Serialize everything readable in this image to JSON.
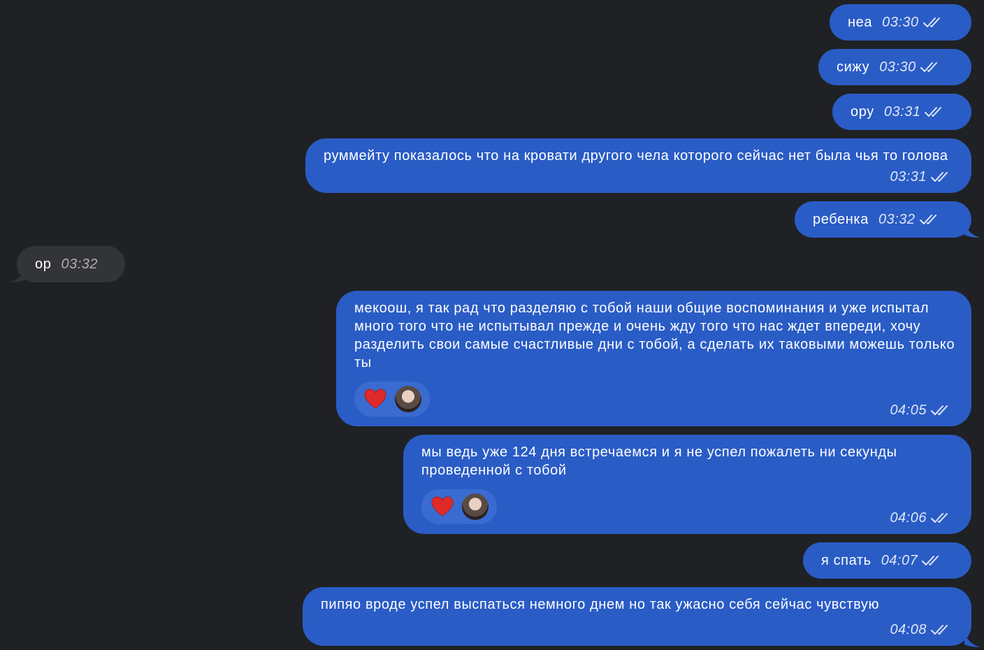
{
  "messages": [
    {
      "id": "m1",
      "direction": "outgoing",
      "text": "неа",
      "time": "03:30",
      "status": "read"
    },
    {
      "id": "m2",
      "direction": "outgoing",
      "text": "сижу",
      "time": "03:30",
      "status": "read"
    },
    {
      "id": "m3",
      "direction": "outgoing",
      "text": "ору",
      "time": "03:31",
      "status": "read"
    },
    {
      "id": "m4",
      "direction": "outgoing",
      "text": "руммейту показалось что на кровати другого чела которого сейчас нет была чья то голова",
      "time": "03:31",
      "status": "read"
    },
    {
      "id": "m5",
      "direction": "outgoing",
      "text": "ребенка",
      "time": "03:32",
      "status": "read"
    },
    {
      "id": "m6",
      "direction": "incoming",
      "text": "ор",
      "time": "03:32"
    },
    {
      "id": "m7",
      "direction": "outgoing",
      "text": "мекоош, я так рад что разделяю с тобой наши общие воспоминания и уже испытал много того что не испытывал прежде и очень жду того что нас ждет впереди, хочу разделить свои самые счастливые дни с тобой, а сделать их таковыми можешь только ты",
      "time": "04:05",
      "status": "read",
      "reaction": "heart-icon"
    },
    {
      "id": "m8",
      "direction": "outgoing",
      "text": "мы ведь уже 124 дня встречаемся и я не успел пожалеть ни секунды проведенной с тобой",
      "time": "04:06",
      "status": "read",
      "reaction": "heart-icon"
    },
    {
      "id": "m9",
      "direction": "outgoing",
      "text": "я спать",
      "time": "04:07",
      "status": "read"
    },
    {
      "id": "m10",
      "direction": "outgoing",
      "text": "пипяо вроде успел выспаться немного днем но так ужасно себя сейчас чувствую",
      "time": "04:08",
      "status": "read"
    }
  ],
  "colors": {
    "background": "#1f2124",
    "outgoing_bubble": "#2a5cc6",
    "incoming_bubble": "#323437",
    "reaction_pill": "#3a6bd0",
    "heart": "#e02a2a"
  },
  "icons": {
    "read_status": "double-check-icon",
    "reaction": "heart-icon",
    "reactor": "avatar"
  }
}
